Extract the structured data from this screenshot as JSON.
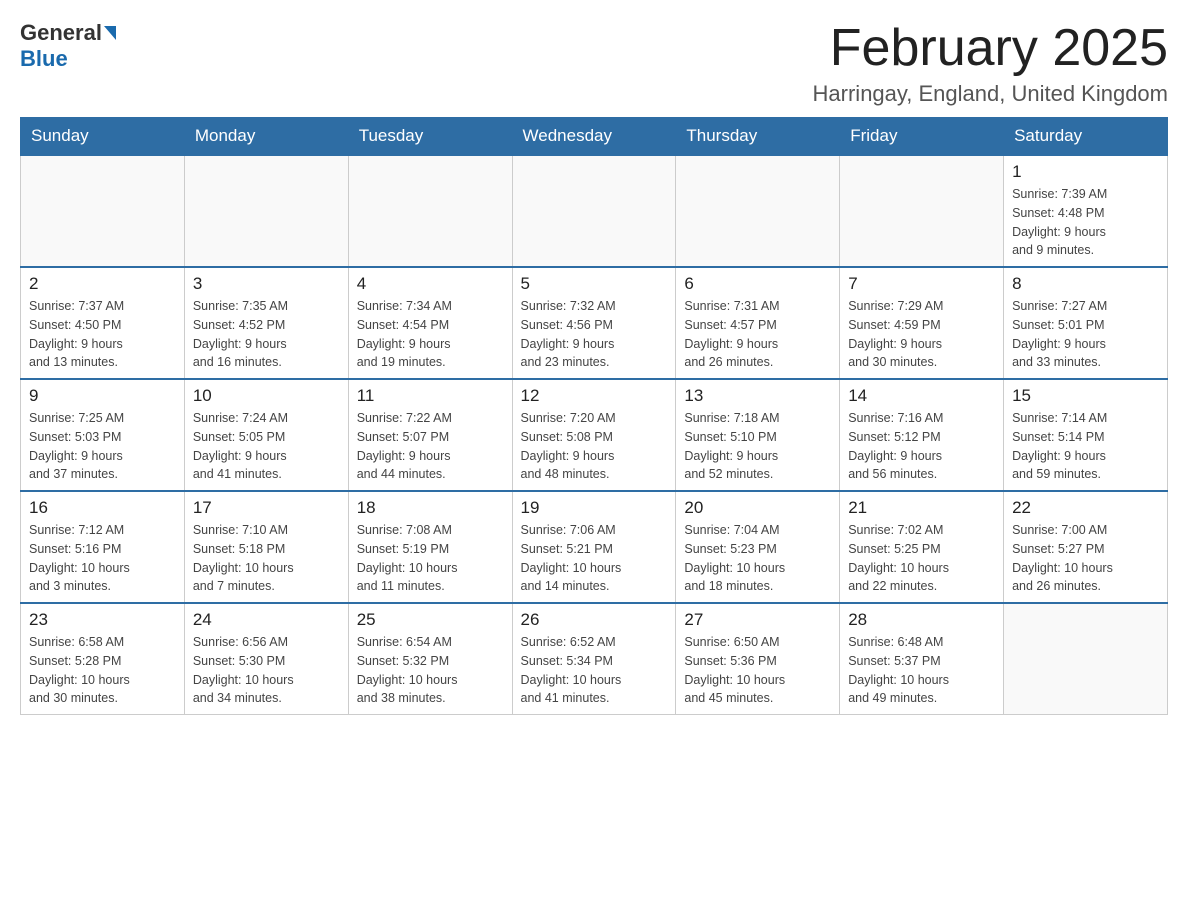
{
  "header": {
    "logo_general": "General",
    "logo_blue": "Blue",
    "month_title": "February 2025",
    "location": "Harringay, England, United Kingdom"
  },
  "weekdays": [
    "Sunday",
    "Monday",
    "Tuesday",
    "Wednesday",
    "Thursday",
    "Friday",
    "Saturday"
  ],
  "weeks": [
    [
      {
        "day": "",
        "info": ""
      },
      {
        "day": "",
        "info": ""
      },
      {
        "day": "",
        "info": ""
      },
      {
        "day": "",
        "info": ""
      },
      {
        "day": "",
        "info": ""
      },
      {
        "day": "",
        "info": ""
      },
      {
        "day": "1",
        "info": "Sunrise: 7:39 AM\nSunset: 4:48 PM\nDaylight: 9 hours\nand 9 minutes."
      }
    ],
    [
      {
        "day": "2",
        "info": "Sunrise: 7:37 AM\nSunset: 4:50 PM\nDaylight: 9 hours\nand 13 minutes."
      },
      {
        "day": "3",
        "info": "Sunrise: 7:35 AM\nSunset: 4:52 PM\nDaylight: 9 hours\nand 16 minutes."
      },
      {
        "day": "4",
        "info": "Sunrise: 7:34 AM\nSunset: 4:54 PM\nDaylight: 9 hours\nand 19 minutes."
      },
      {
        "day": "5",
        "info": "Sunrise: 7:32 AM\nSunset: 4:56 PM\nDaylight: 9 hours\nand 23 minutes."
      },
      {
        "day": "6",
        "info": "Sunrise: 7:31 AM\nSunset: 4:57 PM\nDaylight: 9 hours\nand 26 minutes."
      },
      {
        "day": "7",
        "info": "Sunrise: 7:29 AM\nSunset: 4:59 PM\nDaylight: 9 hours\nand 30 minutes."
      },
      {
        "day": "8",
        "info": "Sunrise: 7:27 AM\nSunset: 5:01 PM\nDaylight: 9 hours\nand 33 minutes."
      }
    ],
    [
      {
        "day": "9",
        "info": "Sunrise: 7:25 AM\nSunset: 5:03 PM\nDaylight: 9 hours\nand 37 minutes."
      },
      {
        "day": "10",
        "info": "Sunrise: 7:24 AM\nSunset: 5:05 PM\nDaylight: 9 hours\nand 41 minutes."
      },
      {
        "day": "11",
        "info": "Sunrise: 7:22 AM\nSunset: 5:07 PM\nDaylight: 9 hours\nand 44 minutes."
      },
      {
        "day": "12",
        "info": "Sunrise: 7:20 AM\nSunset: 5:08 PM\nDaylight: 9 hours\nand 48 minutes."
      },
      {
        "day": "13",
        "info": "Sunrise: 7:18 AM\nSunset: 5:10 PM\nDaylight: 9 hours\nand 52 minutes."
      },
      {
        "day": "14",
        "info": "Sunrise: 7:16 AM\nSunset: 5:12 PM\nDaylight: 9 hours\nand 56 minutes."
      },
      {
        "day": "15",
        "info": "Sunrise: 7:14 AM\nSunset: 5:14 PM\nDaylight: 9 hours\nand 59 minutes."
      }
    ],
    [
      {
        "day": "16",
        "info": "Sunrise: 7:12 AM\nSunset: 5:16 PM\nDaylight: 10 hours\nand 3 minutes."
      },
      {
        "day": "17",
        "info": "Sunrise: 7:10 AM\nSunset: 5:18 PM\nDaylight: 10 hours\nand 7 minutes."
      },
      {
        "day": "18",
        "info": "Sunrise: 7:08 AM\nSunset: 5:19 PM\nDaylight: 10 hours\nand 11 minutes."
      },
      {
        "day": "19",
        "info": "Sunrise: 7:06 AM\nSunset: 5:21 PM\nDaylight: 10 hours\nand 14 minutes."
      },
      {
        "day": "20",
        "info": "Sunrise: 7:04 AM\nSunset: 5:23 PM\nDaylight: 10 hours\nand 18 minutes."
      },
      {
        "day": "21",
        "info": "Sunrise: 7:02 AM\nSunset: 5:25 PM\nDaylight: 10 hours\nand 22 minutes."
      },
      {
        "day": "22",
        "info": "Sunrise: 7:00 AM\nSunset: 5:27 PM\nDaylight: 10 hours\nand 26 minutes."
      }
    ],
    [
      {
        "day": "23",
        "info": "Sunrise: 6:58 AM\nSunset: 5:28 PM\nDaylight: 10 hours\nand 30 minutes."
      },
      {
        "day": "24",
        "info": "Sunrise: 6:56 AM\nSunset: 5:30 PM\nDaylight: 10 hours\nand 34 minutes."
      },
      {
        "day": "25",
        "info": "Sunrise: 6:54 AM\nSunset: 5:32 PM\nDaylight: 10 hours\nand 38 minutes."
      },
      {
        "day": "26",
        "info": "Sunrise: 6:52 AM\nSunset: 5:34 PM\nDaylight: 10 hours\nand 41 minutes."
      },
      {
        "day": "27",
        "info": "Sunrise: 6:50 AM\nSunset: 5:36 PM\nDaylight: 10 hours\nand 45 minutes."
      },
      {
        "day": "28",
        "info": "Sunrise: 6:48 AM\nSunset: 5:37 PM\nDaylight: 10 hours\nand 49 minutes."
      },
      {
        "day": "",
        "info": ""
      }
    ]
  ]
}
